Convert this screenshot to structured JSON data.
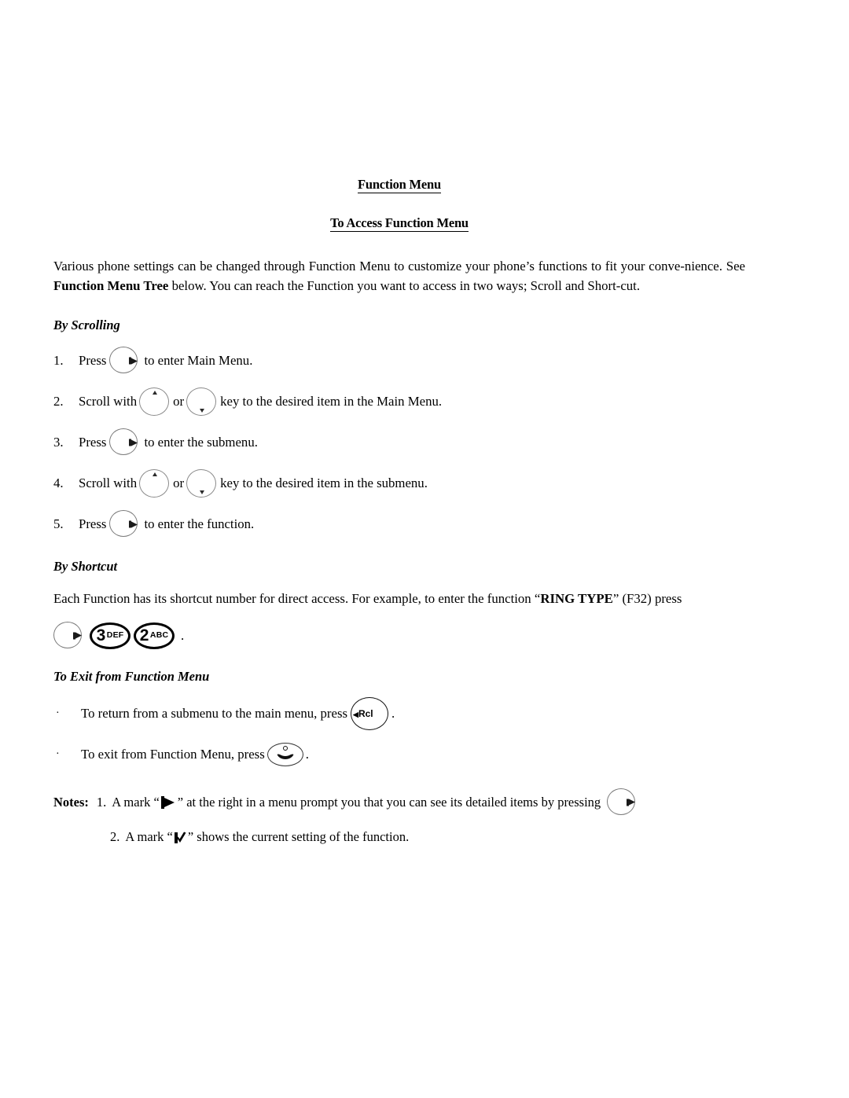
{
  "document": {
    "headings": {
      "main_title": "Function Menu",
      "sub_title": "To Access Function Menu"
    },
    "intro": {
      "part1": "Various phone settings can be changed through Function Menu to customize your phone’s functions to fit your conve-nience.  See ",
      "bold": "Function Menu Tree",
      "part2": " below.  You can reach the Function you want to access in two ways; Scroll and Short-cut."
    },
    "by_scrolling": {
      "heading": "By Scrolling",
      "steps": [
        {
          "number": "1.",
          "text_before": "Press",
          "text_after": "to enter Main Menu."
        },
        {
          "number": "2.",
          "text_before": "Scroll with",
          "middle": "or",
          "text_after": "key to the desired item in the Main Menu."
        },
        {
          "number": "3.",
          "text_before": "Press",
          "text_after": "to enter the submenu."
        },
        {
          "number": "4.",
          "text_before": "Scroll with",
          "middle": "or",
          "text_after": "key to the desired item in the submenu."
        },
        {
          "number": "5.",
          "text_before": "Press",
          "text_after": "to enter the function."
        }
      ]
    },
    "by_shortcut": {
      "heading": "By Shortcut",
      "text_before": "Each Function has its shortcut number for direct access.  For example, to enter the function “",
      "bold": "RING TYPE",
      "text_after": "” (F32) press",
      "keys": [
        {
          "digit": "3",
          "letters": "DEF"
        },
        {
          "digit": "2",
          "letters": "ABC"
        }
      ],
      "period": "."
    },
    "to_exit": {
      "heading": "To Exit from Function Menu",
      "bullets": [
        {
          "marker": "·",
          "text_before": "To return from a submenu to the main menu, press",
          "text_after": "."
        },
        {
          "marker": "·",
          "text_before": "To exit from Function Menu, press",
          "text_after": "."
        }
      ]
    },
    "notes": {
      "label": "Notes:",
      "items": [
        {
          "number": "1.",
          "text_before": "A mark “",
          "text_mid": "” at the right in a menu prompt you that you can see its detailed items by pressing",
          "text_after": ""
        },
        {
          "number": "2.",
          "text_before": "A mark “",
          "text_mid": "” shows the current setting of the function.",
          "text_after": ""
        }
      ]
    },
    "icons": {
      "function_key": "function-softkey-icon",
      "scroll_up_key": "scroll-up-key-icon",
      "scroll_down_key": "scroll-down-key-icon",
      "recall_key_label": "Rcl",
      "recall_key_arrow": "◀",
      "end_call_key": "end-call-key-icon",
      "submenu_mark": "submenu-flag-mark-icon",
      "setting_mark": "current-setting-check-mark-icon"
    },
    "colors": {
      "text": "#000000",
      "background": "#ffffff",
      "key_outline_light": "#7a7a7a",
      "key_outline_dark": "#000000"
    }
  }
}
